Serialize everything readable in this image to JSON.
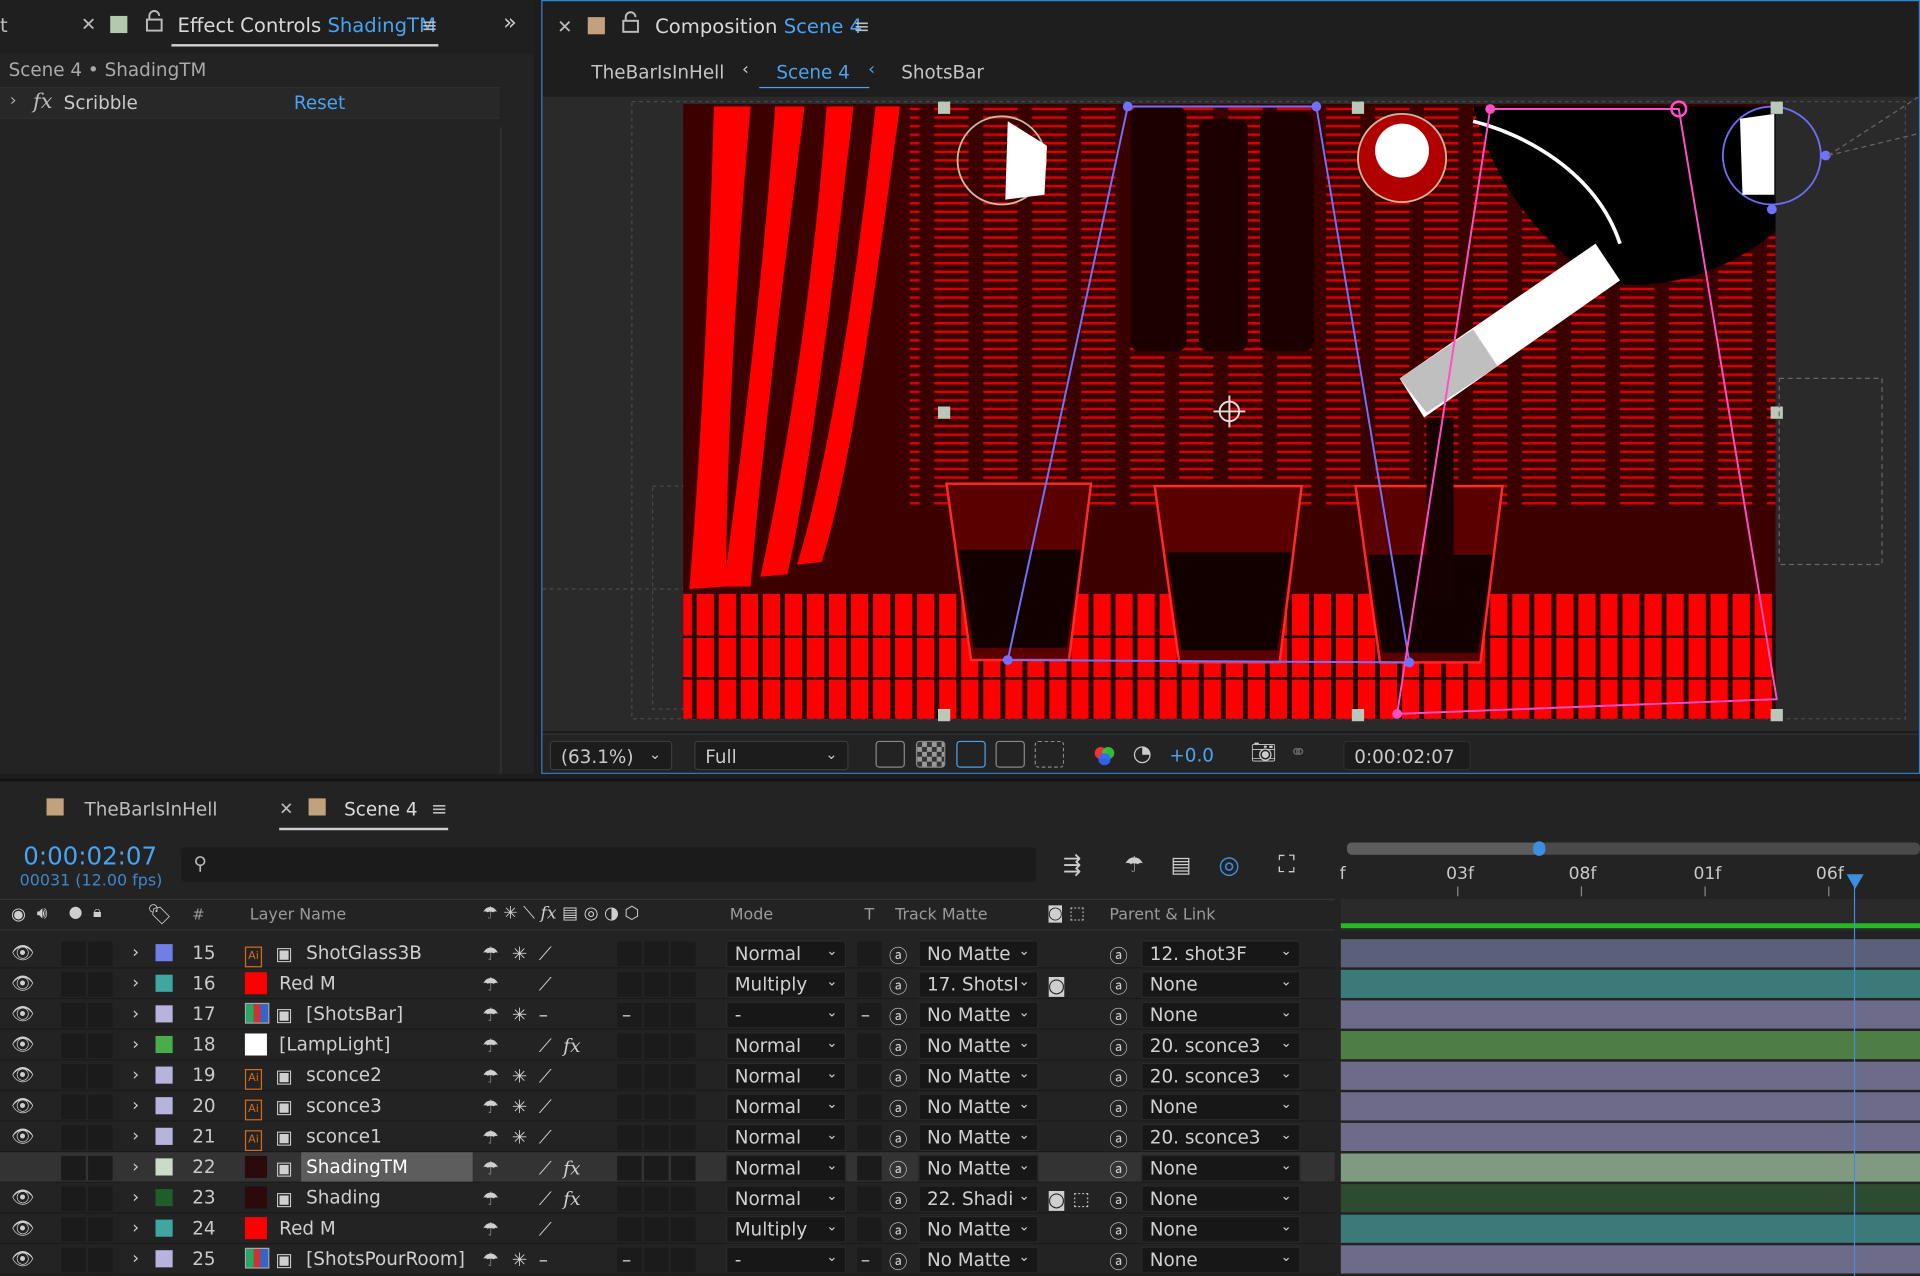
{
  "effect_controls": {
    "tab_prefix": "t",
    "tab_title": "Effect Controls",
    "tab_layer": "ShadingTM",
    "breadcrumb": "Scene 4 • ShadingTM",
    "effect": {
      "fx": "fx",
      "name": "Scribble",
      "reset": "Reset"
    }
  },
  "composition": {
    "tab_title": "Composition",
    "tab_name": "Scene 4",
    "flow": [
      "TheBarIsInHell",
      "Scene 4",
      "ShotsBar"
    ],
    "zoom": "(63.1%)",
    "resolution": "Full",
    "exposure": "+0.0",
    "timecode": "0:00:02:07"
  },
  "timeline": {
    "tabs": [
      "TheBarIsInHell",
      "Scene 4"
    ],
    "current_time": "0:00:02:07",
    "frame_info": "00031 (12.00 fps)",
    "search_placeholder": "",
    "ruler": [
      "f",
      "03f",
      "08f",
      "01f",
      "06f"
    ],
    "headers": {
      "num": "#",
      "layer_name": "Layer Name",
      "mode": "Mode",
      "t": "T",
      "track_matte": "Track Matte",
      "parent": "Parent & Link"
    },
    "layers": [
      {
        "num": "15",
        "name": "ShotGlass3B",
        "label": "#6f7fe6",
        "icon": "ai",
        "mode": "Normal",
        "matte": "No Matte",
        "parent": "12. shot3F",
        "bar": "#5a5f7a"
      },
      {
        "num": "16",
        "name": "Red M",
        "label": "#3fa7a0",
        "icon": "solid-red",
        "mode": "Multiply",
        "matte": "17. ShotsI",
        "parent": "None",
        "bar": "#3a7a78"
      },
      {
        "num": "17",
        "name": "[ShotsBar]",
        "label": "#b7b3dc",
        "icon": "comp",
        "mode": "-",
        "matte": "No Matte",
        "parent": "None",
        "bar": "#6e6b8a"
      },
      {
        "num": "18",
        "name": "[LampLight]",
        "label": "#48ad4a",
        "icon": "solid-white",
        "mode": "Normal",
        "matte": "No Matte",
        "parent": "20. sconce3",
        "bar": "#4e7e45"
      },
      {
        "num": "19",
        "name": "sconce2",
        "label": "#b7b3dc",
        "icon": "ai",
        "mode": "Normal",
        "matte": "No Matte",
        "parent": "20. sconce3",
        "bar": "#6e6b8a"
      },
      {
        "num": "20",
        "name": "sconce3",
        "label": "#b7b3dc",
        "icon": "ai",
        "mode": "Normal",
        "matte": "No Matte",
        "parent": "None",
        "bar": "#6e6b8a"
      },
      {
        "num": "21",
        "name": "sconce1",
        "label": "#b7b3dc",
        "icon": "ai",
        "mode": "Normal",
        "matte": "No Matte",
        "parent": "20. sconce3",
        "bar": "#6e6b8a"
      },
      {
        "num": "22",
        "name": "ShadingTM",
        "label": "#c8dcc6",
        "icon": "solid-dark",
        "mode": "Normal",
        "matte": "No Matte",
        "parent": "None",
        "bar": "#7f9a80"
      },
      {
        "num": "23",
        "name": "Shading",
        "label": "#1f5e2b",
        "icon": "solid-dark",
        "mode": "Normal",
        "matte": "22. Shadi",
        "parent": "None",
        "bar": "#2c4b30"
      },
      {
        "num": "24",
        "name": "Red M",
        "label": "#3fa7a0",
        "icon": "solid-red",
        "mode": "Multiply",
        "matte": "No Matte",
        "parent": "None",
        "bar": "#3a7a78"
      },
      {
        "num": "25",
        "name": "[ShotsPourRoom]",
        "label": "#b7b3dc",
        "icon": "comp",
        "mode": "-",
        "matte": "No Matte",
        "parent": "None",
        "bar": "#6e6b8a"
      }
    ]
  }
}
